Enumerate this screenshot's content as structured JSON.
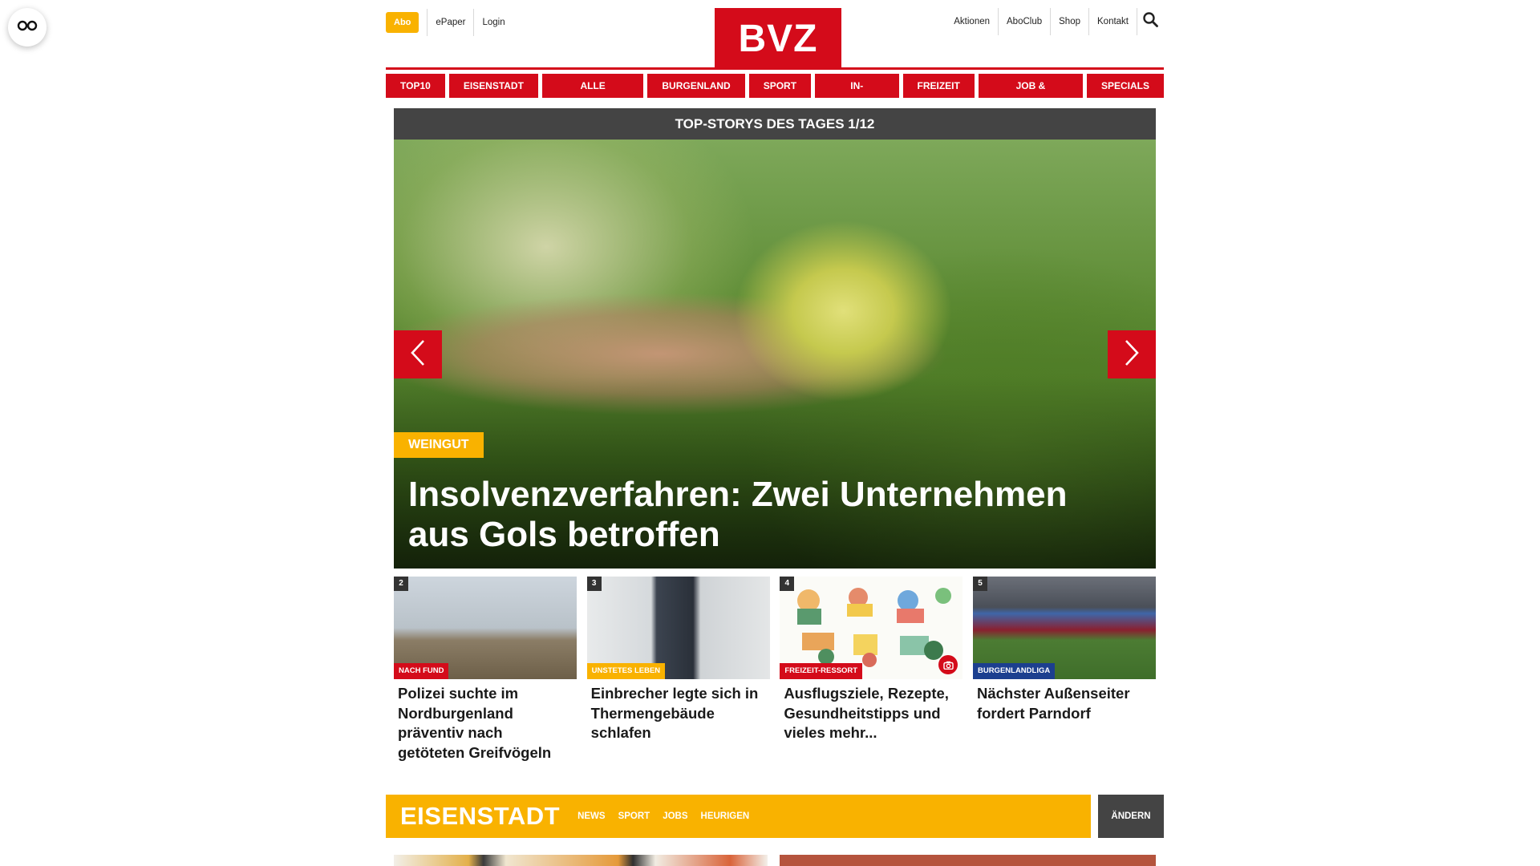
{
  "header": {
    "abo": "Abo",
    "left_links": [
      "ePaper",
      "Login"
    ],
    "logo": "BVZ",
    "right_links": [
      "Aktionen",
      "AboClub",
      "Shop",
      "Kontakt"
    ]
  },
  "nav": {
    "items": [
      "TOP10",
      "EISENSTADT",
      "ALLE REGIONEN",
      "BURGENLAND",
      "SPORT",
      "IN-AUSLAND",
      "FREIZEIT",
      "JOB & KARRIERE",
      "SPECIALS"
    ]
  },
  "slider": {
    "heading": "TOP-STORYS DES TAGES 1/12",
    "tag": "WEINGUT",
    "title": "Insolvenzverfahren: Zwei Unternehmen aus Gols betroffen"
  },
  "cards": [
    {
      "num": "2",
      "tag": "NACH FUND",
      "tag_color": "#d40b1a",
      "title": "Polizei suchte im Nordburgenland präventiv nach getöteten Greifvögeln"
    },
    {
      "num": "3",
      "tag": "UNSTETES LEBEN",
      "tag_color": "#f9b200",
      "title": "Einbrecher legte sich in Thermengebäude schlafen"
    },
    {
      "num": "4",
      "tag": "FREIZEIT-RESSORT",
      "tag_color": "#d40b1a",
      "title": "Ausflugsziele, Rezepte, Gesundheitstipps und vieles mehr..."
    },
    {
      "num": "5",
      "tag": "BURGENLANDLIGA",
      "tag_color": "#1c3f8f",
      "title": "Nächster Außenseiter fordert Parndorf"
    }
  ],
  "section": {
    "title": "EISENSTADT",
    "links": [
      "NEWS",
      "SPORT",
      "JOBS",
      "HEURIGEN"
    ],
    "change": "ÄNDERN"
  },
  "colors": {
    "brand_red": "#d40b1a",
    "accent_yellow": "#f9b200",
    "dark_gray": "#444444"
  },
  "icons": [
    "glasses-icon",
    "search-icon",
    "chevron-left-icon",
    "chevron-right-icon",
    "camera-icon"
  ]
}
